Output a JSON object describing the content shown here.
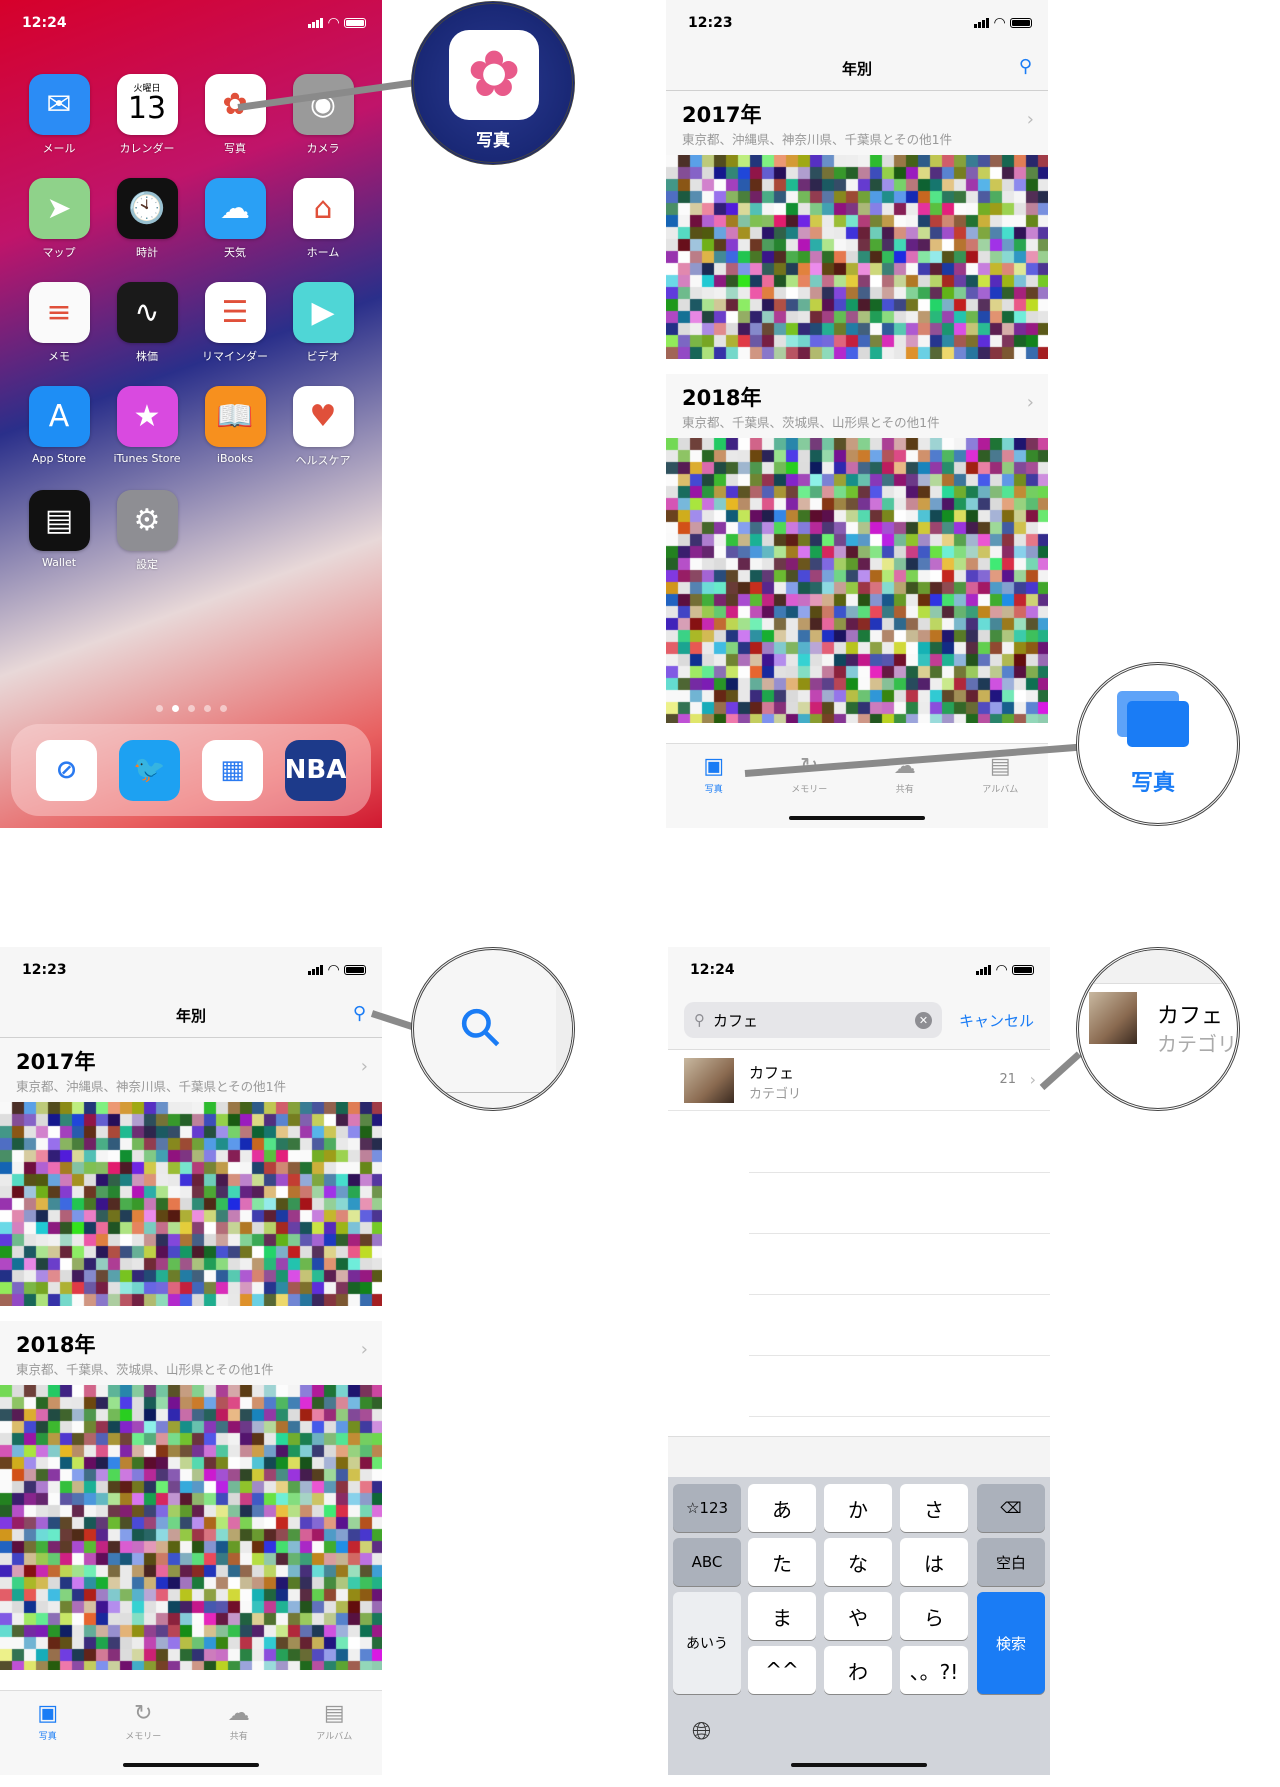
{
  "home": {
    "time": "12:24",
    "apps": [
      {
        "label": "メール",
        "icon": "mail-icon",
        "glyph": "✉",
        "color": "#2b8cf5"
      },
      {
        "label": "カレンダー",
        "icon": "calendar-icon",
        "glyph": "13",
        "sub": "火曜日",
        "color": "#ffffff"
      },
      {
        "label": "写真",
        "icon": "photos-icon",
        "glyph": "✿",
        "color": "#ffffff"
      },
      {
        "label": "カメラ",
        "icon": "camera-icon",
        "glyph": "◉",
        "color": "#9a9a9a"
      },
      {
        "label": "マップ",
        "icon": "maps-icon",
        "glyph": "➤",
        "color": "#8fd28a"
      },
      {
        "label": "時計",
        "icon": "clock-icon",
        "glyph": "🕙",
        "color": "#111111"
      },
      {
        "label": "天気",
        "icon": "weather-icon",
        "glyph": "☁",
        "color": "#2aa0f5"
      },
      {
        "label": "ホーム",
        "icon": "home-icon",
        "glyph": "⌂",
        "color": "#ffffff"
      },
      {
        "label": "メモ",
        "icon": "notes-icon",
        "glyph": "≡",
        "color": "#fafafa"
      },
      {
        "label": "株価",
        "icon": "stocks-icon",
        "glyph": "∿",
        "color": "#1a1a1a"
      },
      {
        "label": "リマインダー",
        "icon": "reminders-icon",
        "glyph": "☰",
        "color": "#ffffff"
      },
      {
        "label": "ビデオ",
        "icon": "videos-icon",
        "glyph": "▶",
        "color": "#4fd6d6"
      },
      {
        "label": "App Store",
        "icon": "app-store-icon",
        "glyph": "A",
        "color": "#1e8ef5"
      },
      {
        "label": "iTunes Store",
        "icon": "itunes-store-icon",
        "glyph": "★",
        "color": "#d94ae0"
      },
      {
        "label": "iBooks",
        "icon": "ibooks-icon",
        "glyph": "📖",
        "color": "#f7901e"
      },
      {
        "label": "ヘルスケア",
        "icon": "health-icon",
        "glyph": "♥",
        "color": "#ffffff"
      },
      {
        "label": "Wallet",
        "icon": "wallet-icon",
        "glyph": "▤",
        "color": "#111111"
      },
      {
        "label": "設定",
        "icon": "settings-icon",
        "glyph": "⚙",
        "color": "#8e8e93"
      }
    ],
    "dock": [
      {
        "icon": "safari-icon",
        "glyph": "⊘",
        "color": "#ffffff"
      },
      {
        "icon": "twitter-icon",
        "glyph": "🐦",
        "color": "#1da1f2"
      },
      {
        "icon": "news-icon",
        "glyph": "▦",
        "color": "#ffffff"
      },
      {
        "icon": "nba-icon",
        "glyph": "NBA",
        "color": "#1d3a8a"
      }
    ],
    "page_count": 5,
    "current_page": 2,
    "magnifier_label": "写真"
  },
  "photos": {
    "time": "12:23",
    "nav_title": "年別",
    "years": [
      {
        "title": "2017年",
        "subtitle": "東京都、沖縄県、神奈川県、千葉県とその他1件"
      },
      {
        "title": "2018年",
        "subtitle": "東京都、千葉県、茨城県、山形県とその他1件"
      }
    ],
    "tabs": [
      {
        "label": "写真",
        "icon": "photos-tab-icon",
        "active": true
      },
      {
        "label": "メモリー",
        "icon": "memories-icon"
      },
      {
        "label": "共有",
        "icon": "shared-cloud-icon"
      },
      {
        "label": "アルバム",
        "icon": "albums-icon"
      }
    ],
    "magnifier_label": "写真"
  },
  "search": {
    "time": "12:24",
    "query": "カフェ",
    "cancel": "キャンセル",
    "result": {
      "name": "カフェ",
      "category": "カテゴリ",
      "count": "21"
    },
    "keys": [
      {
        "label": "☆123",
        "style": "g",
        "r": 0,
        "c": 0
      },
      {
        "label": "あ",
        "r": 0,
        "c": 1
      },
      {
        "label": "か",
        "r": 0,
        "c": 2
      },
      {
        "label": "さ",
        "r": 0,
        "c": 3
      },
      {
        "label": "⌫",
        "style": "g",
        "r": 0,
        "c": 4,
        "name": "delete-key"
      },
      {
        "label": "ABC",
        "style": "g",
        "r": 1,
        "c": 0
      },
      {
        "label": "た",
        "r": 1,
        "c": 1
      },
      {
        "label": "な",
        "r": 1,
        "c": 2
      },
      {
        "label": "は",
        "r": 1,
        "c": 3
      },
      {
        "label": "空白",
        "style": "g",
        "r": 1,
        "c": 4
      },
      {
        "label": "あいう",
        "style": "lt",
        "r": 2,
        "c": 0,
        "tall": true
      },
      {
        "label": "ま",
        "r": 2,
        "c": 1
      },
      {
        "label": "や",
        "r": 2,
        "c": 2
      },
      {
        "label": "ら",
        "r": 2,
        "c": 3
      },
      {
        "label": "検索",
        "style": "blue",
        "r": 2,
        "c": 4,
        "tall": true
      },
      {
        "label": "^^",
        "r": 3,
        "c": 1
      },
      {
        "label": "わ",
        "r": 3,
        "c": 2
      },
      {
        "label": "、。?!",
        "r": 3,
        "c": 3
      }
    ],
    "magnifier": {
      "name": "カフェ",
      "category": "カテゴリ"
    }
  },
  "colors": {
    "accent": "#1a7cf5"
  }
}
